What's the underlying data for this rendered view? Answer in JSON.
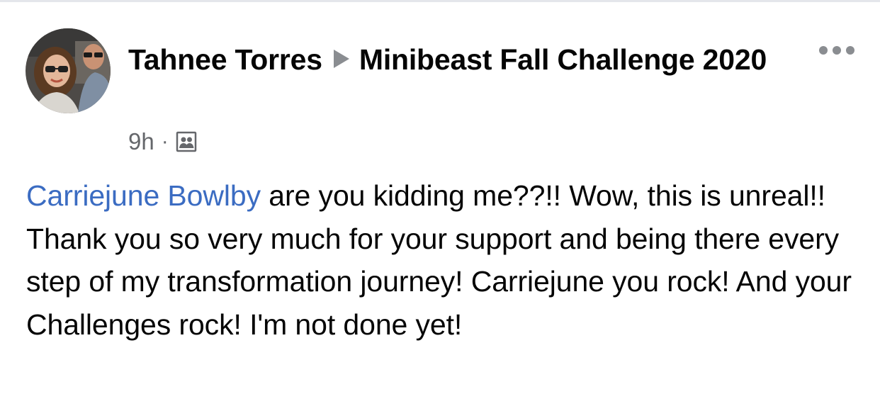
{
  "post": {
    "author": "Tahnee Torres",
    "group": "Minibeast Fall Challenge 2020",
    "timestamp": "9h",
    "separator": "·",
    "audience_icon": "group-members-icon",
    "more_icon": "more-options-icon",
    "mention": "Carriejune Bowlby",
    "message": " are you kidding me??!! Wow, this is unreal!! Thank you so very much for your support and being there every step of my transformation journey! Carriejune you rock! And your Challenges rock! I'm not done yet!"
  },
  "colors": {
    "mention": "#3b6cc2",
    "meta_text": "#65676b",
    "primary_text": "#050505"
  }
}
